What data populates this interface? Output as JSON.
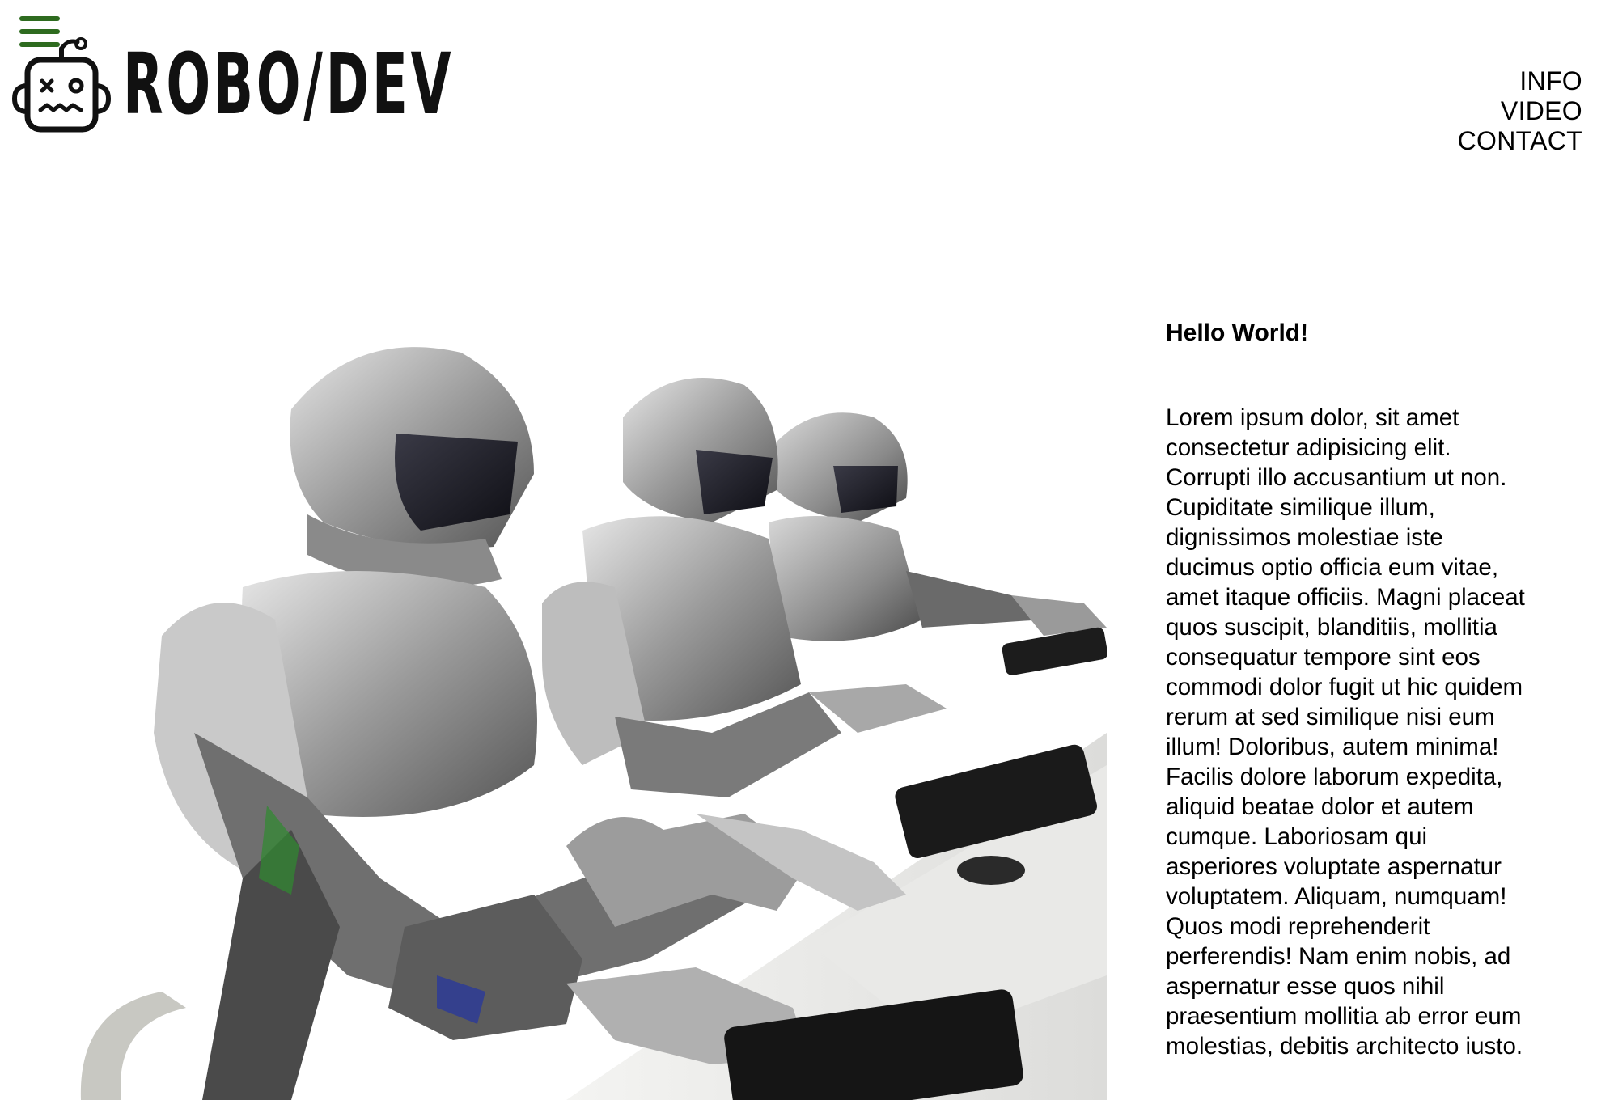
{
  "header": {
    "brand": "ROBO/DEV",
    "menu_icon": "hamburger-menu-icon",
    "logo_icon": "robot-head-icon",
    "accent_color": "#2e6b1f"
  },
  "nav": {
    "items": [
      {
        "label": "INFO"
      },
      {
        "label": "VIDEO"
      },
      {
        "label": "CONTACT"
      }
    ]
  },
  "main": {
    "heading": "Hello World!",
    "body": "Lorem ipsum dolor, sit amet consectetur adipisicing elit. Corrupti illo accusantium ut non. Cupiditate similique illum, dignissimos molestiae iste ducimus optio officia eum vitae, amet itaque officiis. Magni placeat quos suscipit, blanditiis, mollitia consequatur tempore sint eos commodi dolor fugit ut hic quidem rerum at sed similique nisi eum illum! Doloribus, autem minima! Facilis dolore laborum expedita, aliquid beatae dolor et autem cumque. Laboriosam qui asperiores voluptate aspernatur voluptatem. Aliquam, numquam! Quos modi reprehenderit perferendis! Nam enim nobis, ad aspernatur esse quos nihil praesentium mollitia ab error eum molestias, debitis architecto iusto."
  }
}
